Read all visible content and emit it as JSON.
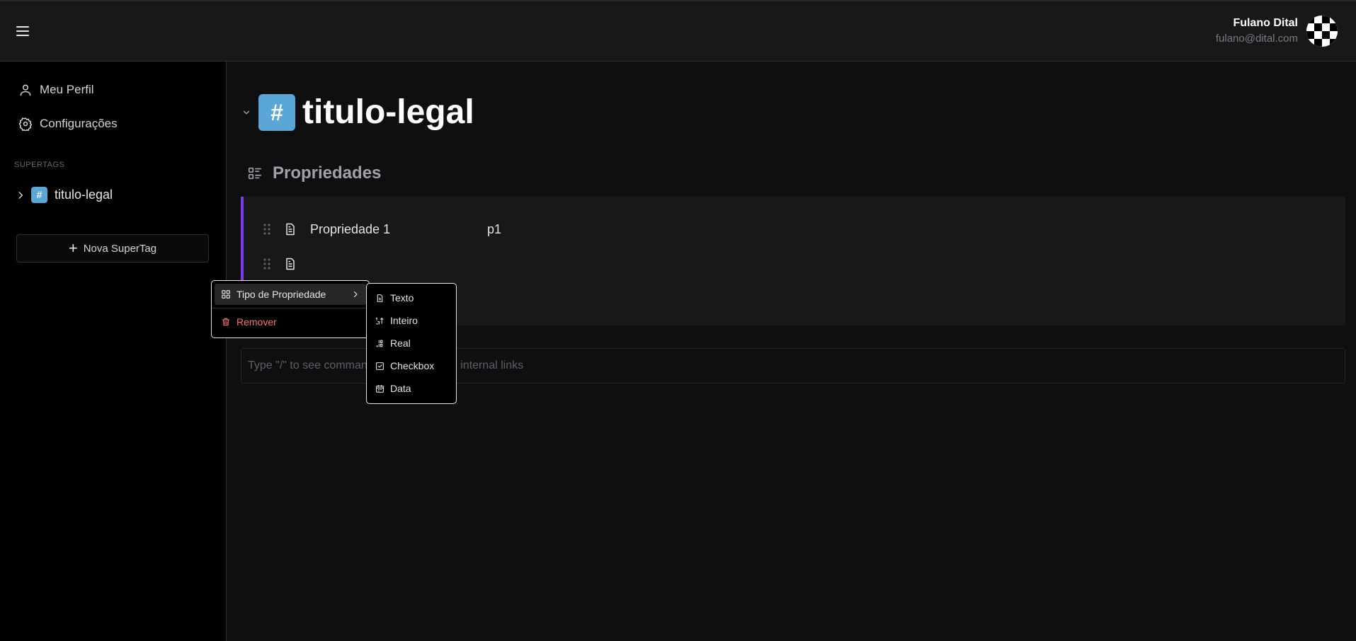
{
  "header": {
    "menu_icon": "hamburger-menu-icon",
    "user_name": "Fulano Dital",
    "user_email": "fulano@dital.com"
  },
  "sidebar": {
    "items": [
      {
        "label": "Meu Perfil",
        "icon": "user-icon"
      },
      {
        "label": "Configurações",
        "icon": "gear-icon"
      }
    ],
    "section_label": "SUPERTAGS",
    "tags": [
      {
        "hash": "#",
        "label": "titulo-legal"
      }
    ],
    "new_tag_label": "Nova SuperTag"
  },
  "main": {
    "hash": "#",
    "title": "titulo-legal",
    "properties_label": "Propriedades",
    "properties": [
      {
        "name": "Propriedade 1",
        "value": "p1"
      },
      {
        "name": "",
        "value": ""
      }
    ],
    "editor_placeholder": "Type \"/\" to see commands or \"[[\" to create internal links"
  },
  "context_menu": {
    "type_label": "Tipo de Propriedade",
    "remove_label": "Remover"
  },
  "type_submenu": {
    "options": [
      {
        "label": "Texto",
        "icon": "document-icon"
      },
      {
        "label": "Inteiro",
        "icon": "integer-icon"
      },
      {
        "label": "Real",
        "icon": "decimal-icon"
      },
      {
        "label": "Checkbox",
        "icon": "checkbox-icon"
      },
      {
        "label": "Data",
        "icon": "calendar-icon"
      }
    ]
  },
  "colors": {
    "accent_border": "#7c3aed",
    "hash_badge": "#5aa6d6",
    "danger": "#f87171"
  }
}
